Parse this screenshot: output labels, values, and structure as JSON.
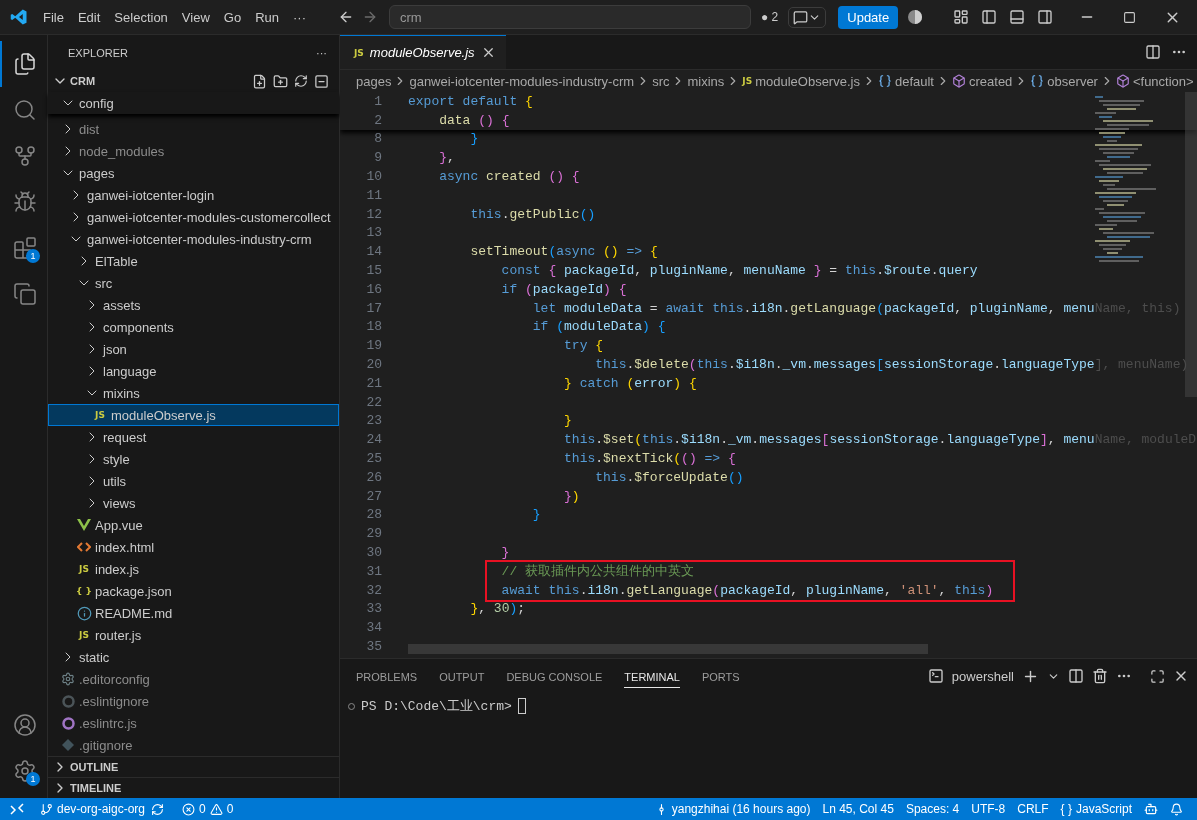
{
  "title_bar": {
    "menus": [
      "File",
      "Edit",
      "Selection",
      "View",
      "Go",
      "Run",
      "···"
    ],
    "search": {
      "value": "crm"
    },
    "changes": "● 2",
    "update_button": "Update"
  },
  "activity_bar": {
    "top": [
      {
        "kind": "explorer",
        "selected": true
      },
      {
        "kind": "search",
        "selected": false
      },
      {
        "kind": "source-control",
        "selected": false
      },
      {
        "kind": "run-debug",
        "selected": false
      },
      {
        "kind": "extensions",
        "selected": false,
        "badge": "1"
      },
      {
        "kind": "remote",
        "selected": false
      }
    ],
    "bottom": [
      {
        "kind": "account",
        "selected": false
      },
      {
        "kind": "settings",
        "selected": false,
        "badge": "1"
      }
    ]
  },
  "sidebar": {
    "title": "EXPLORER",
    "more": "···",
    "root": "CRM",
    "sticky_folder": {
      "name": "config",
      "kind": "folder",
      "expanded": true
    },
    "tree": [
      {
        "name": "dist",
        "kind": "folder",
        "expanded": false,
        "ignored": true
      },
      {
        "name": "node_modules",
        "kind": "folder",
        "expanded": false,
        "ignored": true
      },
      {
        "name": "pages",
        "kind": "folder",
        "expanded": true,
        "children": [
          {
            "name": "ganwei-iotcenter-login",
            "kind": "folder",
            "expanded": false
          },
          {
            "name": "ganwei-iotcenter-modules-customercollect",
            "kind": "folder",
            "expanded": false
          },
          {
            "name": "ganwei-iotcenter-modules-industry-crm",
            "kind": "folder",
            "expanded": true,
            "children": [
              {
                "name": "ElTable",
                "kind": "folder",
                "expanded": false
              },
              {
                "name": "src",
                "kind": "folder",
                "expanded": true,
                "children": [
                  {
                    "name": "assets",
                    "kind": "folder",
                    "expanded": false
                  },
                  {
                    "name": "components",
                    "kind": "folder",
                    "expanded": false
                  },
                  {
                    "name": "json",
                    "kind": "folder",
                    "expanded": false
                  },
                  {
                    "name": "language",
                    "kind": "folder",
                    "expanded": false
                  },
                  {
                    "name": "mixins",
                    "kind": "folder",
                    "expanded": true,
                    "children": [
                      {
                        "name": "moduleObserve.js",
                        "kind": "js",
                        "icon_label": "JS",
                        "selected": true
                      }
                    ]
                  },
                  {
                    "name": "request",
                    "kind": "folder",
                    "expanded": false
                  },
                  {
                    "name": "style",
                    "kind": "folder",
                    "expanded": false
                  },
                  {
                    "name": "utils",
                    "kind": "folder",
                    "expanded": false
                  },
                  {
                    "name": "views",
                    "kind": "folder",
                    "expanded": false
                  }
                ]
              },
              {
                "name": "App.vue",
                "kind": "vue"
              },
              {
                "name": "index.html",
                "kind": "html"
              },
              {
                "name": "index.js",
                "kind": "js",
                "icon_label": "JS"
              },
              {
                "name": "package.json",
                "kind": "json",
                "icon_label": "{ }"
              },
              {
                "name": "README.md",
                "kind": "info"
              },
              {
                "name": "router.js",
                "kind": "js",
                "icon_label": "JS"
              }
            ]
          }
        ]
      },
      {
        "name": "static",
        "kind": "folder",
        "expanded": false
      },
      {
        "name": ".editorconfig",
        "kind": "config",
        "ignored": true
      },
      {
        "name": ".eslintignore",
        "kind": "eslintignore",
        "ignored": true
      },
      {
        "name": ".eslintrc.js",
        "kind": "eslintrc",
        "ignored": true
      },
      {
        "name": ".gitignore",
        "kind": "gitignore",
        "ignored": true
      }
    ],
    "sections": [
      {
        "title": "OUTLINE",
        "expanded": false
      },
      {
        "title": "TIMELINE",
        "expanded": false
      }
    ]
  },
  "editor": {
    "tab": {
      "icon_label": "JS",
      "title": "moduleObserve.js",
      "preview": true
    },
    "breadcrumbs": [
      {
        "text": "pages",
        "kind": "folder"
      },
      {
        "text": "ganwei-iotcenter-modules-industry-crm",
        "kind": "folder"
      },
      {
        "text": "src",
        "kind": "folder"
      },
      {
        "text": "mixins",
        "kind": "folder"
      },
      {
        "text": "moduleObserve.js",
        "kind": "js",
        "icon_label": "JS"
      },
      {
        "text": "default",
        "kind": "module"
      },
      {
        "text": "created",
        "kind": "method"
      },
      {
        "text": "observer",
        "kind": "module"
      },
      {
        "text": "<function>",
        "kind": "method"
      }
    ],
    "sticky_lines": [
      {
        "num": "1",
        "tokens": [
          {
            "text": "export default",
            "kind": "kw"
          },
          {
            "text": " {",
            "kind": "b1"
          }
        ]
      },
      {
        "num": "2",
        "tokens": [
          {
            "text": "    data",
            "kind": "fn"
          },
          {
            "text": " ()",
            "kind": "b2"
          },
          {
            "text": " {",
            "kind": "b2"
          }
        ]
      }
    ],
    "lines": [
      {
        "num": "8",
        "tokens": [
          {
            "text": "        }",
            "kind": "b3"
          }
        ]
      },
      {
        "num": "9",
        "tokens": [
          {
            "text": "    }",
            "kind": "b2"
          },
          {
            "text": ",",
            "kind": "p"
          }
        ]
      },
      {
        "num": "10",
        "tokens": [
          {
            "text": "    async",
            "kind": "kw"
          },
          {
            "text": " created",
            "kind": "fn"
          },
          {
            "text": " ()",
            "kind": "b2"
          },
          {
            "text": " {",
            "kind": "b2"
          }
        ]
      },
      {
        "num": "11"
      },
      {
        "num": "12",
        "tokens": [
          {
            "text": "        this",
            "kind": "kw"
          },
          {
            "text": ".",
            "kind": "p"
          },
          {
            "text": "getPublic",
            "kind": "fn"
          },
          {
            "text": "()",
            "kind": "b3"
          }
        ]
      },
      {
        "num": "13"
      },
      {
        "num": "14",
        "tokens": [
          {
            "text": "        setTimeout",
            "kind": "fn"
          },
          {
            "text": "(",
            "kind": "b3"
          },
          {
            "text": "async",
            "kind": "kw"
          },
          {
            "text": " ()",
            "kind": "b1"
          },
          {
            "text": " =>",
            "kind": "kw"
          },
          {
            "text": " {",
            "kind": "b1"
          }
        ]
      },
      {
        "num": "15",
        "tokens": [
          {
            "text": "            const",
            "kind": "kw"
          },
          {
            "text": " {",
            "kind": "b2"
          },
          {
            "text": " packageId",
            "kind": "var"
          },
          {
            "text": ", ",
            "kind": "p"
          },
          {
            "text": "pluginName",
            "kind": "var"
          },
          {
            "text": ", ",
            "kind": "p"
          },
          {
            "text": "menuName",
            "kind": "var"
          },
          {
            "text": " }",
            "kind": "b2"
          },
          {
            "text": " = ",
            "kind": "p"
          },
          {
            "text": "this",
            "kind": "kw"
          },
          {
            "text": ".",
            "kind": "p"
          },
          {
            "text": "$route",
            "kind": "var"
          },
          {
            "text": ".",
            "kind": "p"
          },
          {
            "text": "query",
            "kind": "var"
          }
        ]
      },
      {
        "num": "16",
        "tokens": [
          {
            "text": "            if",
            "kind": "kw"
          },
          {
            "text": " (",
            "kind": "b2"
          },
          {
            "text": "packageId",
            "kind": "var"
          },
          {
            "text": ")",
            "kind": "b2"
          },
          {
            "text": " {",
            "kind": "b2"
          }
        ]
      },
      {
        "num": "17",
        "tokens": [
          {
            "text": "                let",
            "kind": "kw"
          },
          {
            "text": " moduleData",
            "kind": "var"
          },
          {
            "text": " = ",
            "kind": "p"
          },
          {
            "text": "await",
            "kind": "kw"
          },
          {
            "text": " this",
            "kind": "kw"
          },
          {
            "text": ".",
            "kind": "p"
          },
          {
            "text": "i18n",
            "kind": "var"
          },
          {
            "text": ".",
            "kind": "p"
          },
          {
            "text": "getLanguage",
            "kind": "fn"
          },
          {
            "text": "(",
            "kind": "b3"
          },
          {
            "text": "packageId",
            "kind": "var"
          },
          {
            "text": ", ",
            "kind": "p"
          },
          {
            "text": "pluginName",
            "kind": "var"
          },
          {
            "text": ", ",
            "kind": "p"
          },
          {
            "text": "menu",
            "kind": "var"
          },
          {
            "text": "Name, this)",
            "kind": "fade"
          }
        ]
      },
      {
        "num": "18",
        "tokens": [
          {
            "text": "                if",
            "kind": "kw"
          },
          {
            "text": " (",
            "kind": "b3"
          },
          {
            "text": "moduleData",
            "kind": "var"
          },
          {
            "text": ")",
            "kind": "b3"
          },
          {
            "text": " {",
            "kind": "b3"
          }
        ]
      },
      {
        "num": "19",
        "tokens": [
          {
            "text": "                    try",
            "kind": "kw"
          },
          {
            "text": " {",
            "kind": "b1"
          }
        ]
      },
      {
        "num": "20",
        "tokens": [
          {
            "text": "                        this",
            "kind": "kw"
          },
          {
            "text": ".",
            "kind": "p"
          },
          {
            "text": "$delete",
            "kind": "fn"
          },
          {
            "text": "(",
            "kind": "b2"
          },
          {
            "text": "this",
            "kind": "kw"
          },
          {
            "text": ".",
            "kind": "p"
          },
          {
            "text": "$i18n",
            "kind": "var"
          },
          {
            "text": ".",
            "kind": "p"
          },
          {
            "text": "_vm",
            "kind": "var"
          },
          {
            "text": ".",
            "kind": "p"
          },
          {
            "text": "messages",
            "kind": "var"
          },
          {
            "text": "[",
            "kind": "b3"
          },
          {
            "text": "sessionStorage",
            "kind": "var"
          },
          {
            "text": ".",
            "kind": "p"
          },
          {
            "text": "languageType",
            "kind": "var"
          },
          {
            "text": "], menuName)",
            "kind": "fade"
          }
        ]
      },
      {
        "num": "21",
        "tokens": [
          {
            "text": "                    }",
            "kind": "b1"
          },
          {
            "text": " catch",
            "kind": "kw"
          },
          {
            "text": " (",
            "kind": "b1"
          },
          {
            "text": "error",
            "kind": "var"
          },
          {
            "text": ")",
            "kind": "b1"
          },
          {
            "text": " {",
            "kind": "b1"
          }
        ]
      },
      {
        "num": "22"
      },
      {
        "num": "23",
        "tokens": [
          {
            "text": "                    }",
            "kind": "b1"
          }
        ]
      },
      {
        "num": "24",
        "tokens": [
          {
            "text": "                    this",
            "kind": "kw"
          },
          {
            "text": ".",
            "kind": "p"
          },
          {
            "text": "$set",
            "kind": "fn"
          },
          {
            "text": "(",
            "kind": "b1"
          },
          {
            "text": "this",
            "kind": "kw"
          },
          {
            "text": ".",
            "kind": "p"
          },
          {
            "text": "$i18n",
            "kind": "var"
          },
          {
            "text": ".",
            "kind": "p"
          },
          {
            "text": "_vm",
            "kind": "var"
          },
          {
            "text": ".",
            "kind": "p"
          },
          {
            "text": "messages",
            "kind": "var"
          },
          {
            "text": "[",
            "kind": "b2"
          },
          {
            "text": "sessionStorage",
            "kind": "var"
          },
          {
            "text": ".",
            "kind": "p"
          },
          {
            "text": "languageType",
            "kind": "var"
          },
          {
            "text": "]",
            "kind": "b2"
          },
          {
            "text": ", ",
            "kind": "p"
          },
          {
            "text": "menu",
            "kind": "var"
          },
          {
            "text": "Name, moduleD",
            "kind": "fade"
          }
        ]
      },
      {
        "num": "25",
        "tokens": [
          {
            "text": "                    this",
            "kind": "kw"
          },
          {
            "text": ".",
            "kind": "p"
          },
          {
            "text": "$nextTick",
            "kind": "fn"
          },
          {
            "text": "(",
            "kind": "b1"
          },
          {
            "text": "()",
            "kind": "b2"
          },
          {
            "text": " =>",
            "kind": "kw"
          },
          {
            "text": " {",
            "kind": "b2"
          }
        ]
      },
      {
        "num": "26",
        "tokens": [
          {
            "text": "                        this",
            "kind": "kw"
          },
          {
            "text": ".",
            "kind": "p"
          },
          {
            "text": "$forceUpdate",
            "kind": "fn"
          },
          {
            "text": "()",
            "kind": "b3"
          }
        ]
      },
      {
        "num": "27",
        "tokens": [
          {
            "text": "                    }",
            "kind": "b2"
          },
          {
            "text": ")",
            "kind": "b1"
          }
        ]
      },
      {
        "num": "28",
        "tokens": [
          {
            "text": "                }",
            "kind": "b3"
          }
        ]
      },
      {
        "num": "29"
      },
      {
        "num": "30",
        "tokens": [
          {
            "text": "            }",
            "kind": "b2"
          }
        ]
      },
      {
        "num": "31",
        "boxed": true,
        "tokens": [
          {
            "text": "            // 获取插件内公共组件的中英文",
            "kind": "com"
          }
        ]
      },
      {
        "num": "32",
        "boxed": true,
        "tokens": [
          {
            "text": "            await",
            "kind": "kw"
          },
          {
            "text": " this",
            "kind": "kw"
          },
          {
            "text": ".",
            "kind": "p"
          },
          {
            "text": "i18n",
            "kind": "var"
          },
          {
            "text": ".",
            "kind": "p"
          },
          {
            "text": "getLanguage",
            "kind": "fn"
          },
          {
            "text": "(",
            "kind": "b2"
          },
          {
            "text": "packageId",
            "kind": "var"
          },
          {
            "text": ", ",
            "kind": "p"
          },
          {
            "text": "pluginName",
            "kind": "var"
          },
          {
            "text": ", ",
            "kind": "p"
          },
          {
            "text": "'all'",
            "kind": "str"
          },
          {
            "text": ", ",
            "kind": "p"
          },
          {
            "text": "this",
            "kind": "kw"
          },
          {
            "text": ")",
            "kind": "b2"
          }
        ]
      },
      {
        "num": "33",
        "tokens": [
          {
            "text": "        }",
            "kind": "b1"
          },
          {
            "text": ", ",
            "kind": "p"
          },
          {
            "text": "30",
            "kind": "num"
          },
          {
            "text": ")",
            "kind": "b3"
          },
          {
            "text": ";",
            "kind": "p"
          }
        ]
      },
      {
        "num": "34"
      },
      {
        "num": "35"
      }
    ]
  },
  "panel": {
    "tabs": [
      {
        "label": "PROBLEMS",
        "selected": false
      },
      {
        "label": "OUTPUT",
        "selected": false
      },
      {
        "label": "DEBUG CONSOLE",
        "selected": false
      },
      {
        "label": "TERMINAL",
        "selected": true
      },
      {
        "label": "PORTS",
        "selected": false
      }
    ],
    "shell": "powershell",
    "prompt": "PS D:\\Code\\工业\\crm>"
  },
  "status_bar": {
    "branch": "dev-org-aigc-org",
    "errors": "0",
    "warnings": "0",
    "blame": "yangzhihai (16 hours ago)",
    "position": "Ln 45, Col 45",
    "spaces": "Spaces: 4",
    "encoding": "UTF-8",
    "eol": "CRLF",
    "language_icon": "{ }",
    "language": "JavaScript"
  }
}
